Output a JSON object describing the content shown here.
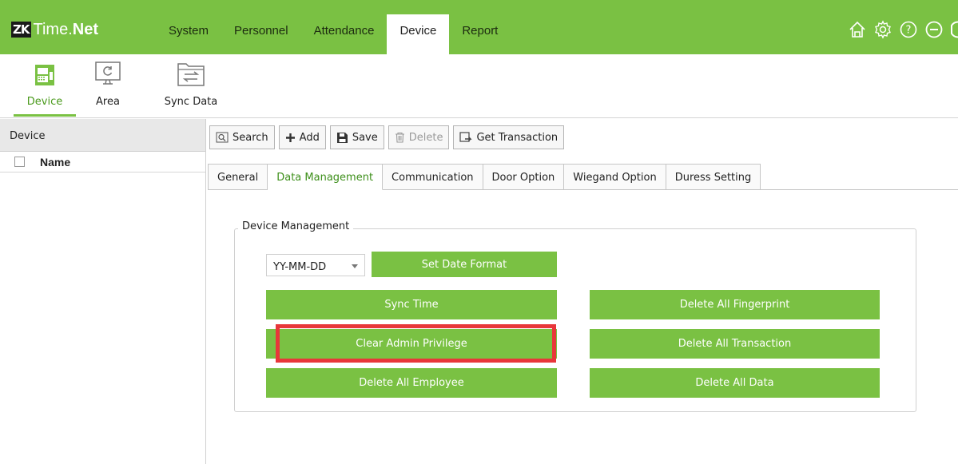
{
  "app": {
    "logo_badge": "ZK",
    "logo_time": "Time.",
    "logo_net": "Net"
  },
  "menu": {
    "items": [
      {
        "label": "System"
      },
      {
        "label": "Personnel"
      },
      {
        "label": "Attendance"
      },
      {
        "label": "Device",
        "active": true
      },
      {
        "label": "Report"
      }
    ]
  },
  "top_icons": [
    "home-icon",
    "gear-icon",
    "help-icon",
    "minimize-icon",
    "close-icon"
  ],
  "toolbar": {
    "device_label": "Device",
    "area_label": "Area",
    "sync_label": "Sync Data"
  },
  "left_panel": {
    "header": "Device",
    "column_name": "Name"
  },
  "actions": {
    "search": "Search",
    "add": "Add",
    "save": "Save",
    "delete": "Delete",
    "get_transaction": "Get Transaction"
  },
  "tabs": {
    "general": "General",
    "data_management": "Data Management",
    "communication": "Communication",
    "door_option": "Door Option",
    "wiegand_option": "Wiegand Option",
    "duress_setting": "Duress Setting",
    "active": "Data Management"
  },
  "device_management": {
    "legend": "Device Management",
    "date_format_value": "YY-MM-DD",
    "set_date_format": "Set Date Format",
    "sync_time": "Sync Time",
    "clear_admin_privilege": "Clear Admin Privilege",
    "delete_all_employee": "Delete All Employee",
    "delete_all_fingerprint": "Delete All Fingerprint",
    "delete_all_transaction": "Delete All Transaction",
    "delete_all_data": "Delete All Data"
  },
  "colors": {
    "accent": "#7ac143",
    "highlight": "#e8373a",
    "active_text": "#3d8f1a"
  }
}
